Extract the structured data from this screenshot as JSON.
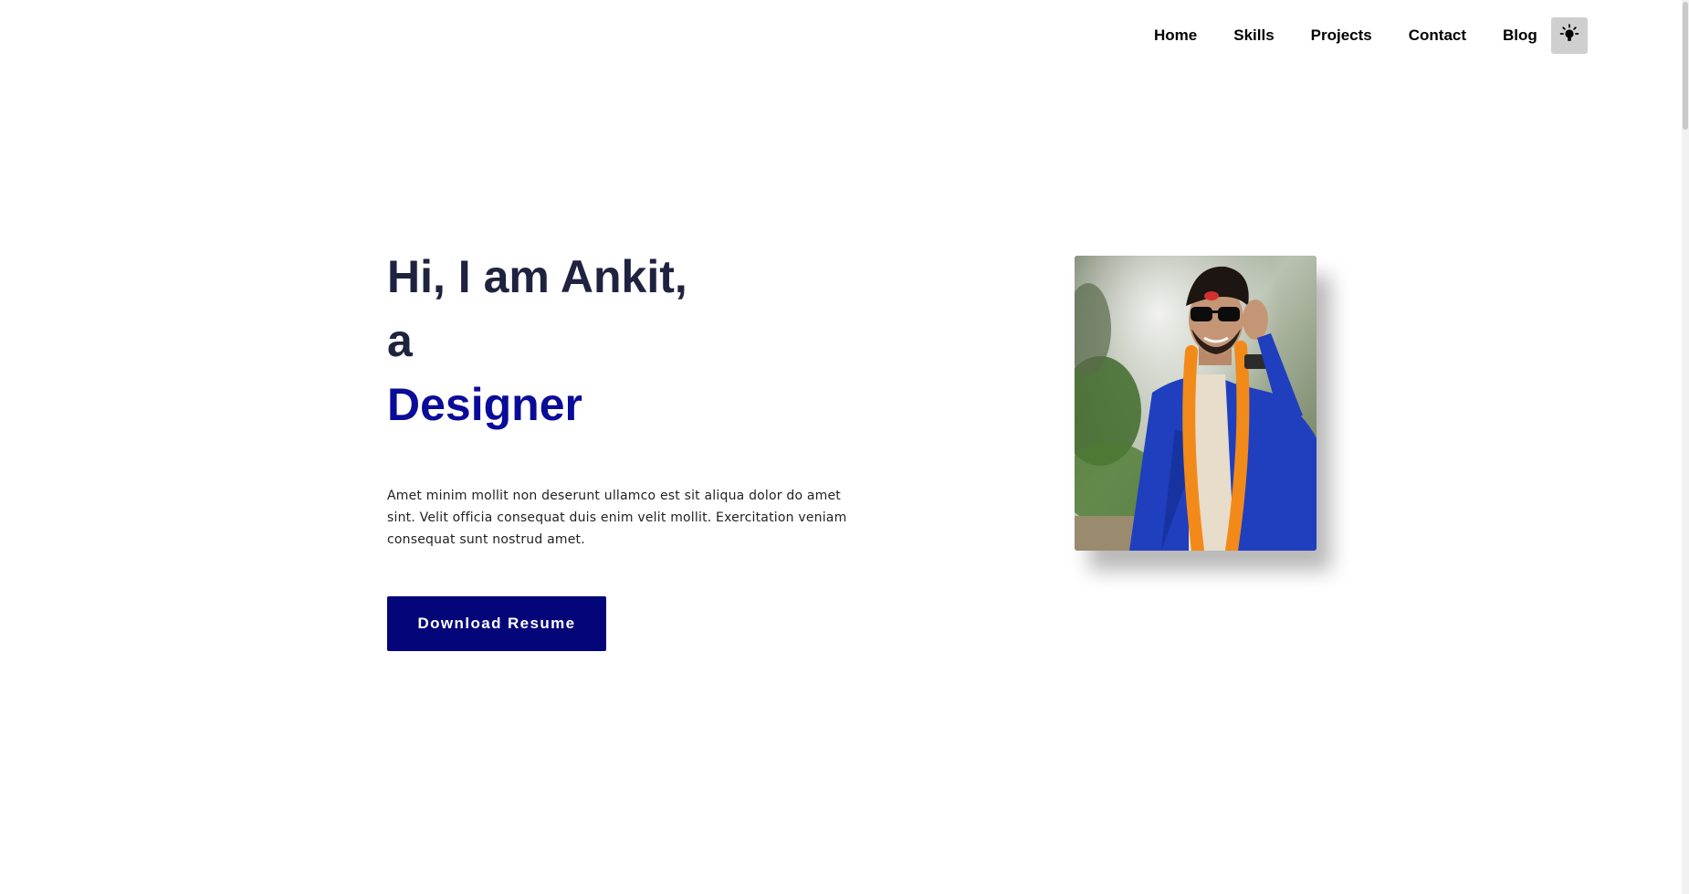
{
  "nav": {
    "links": [
      {
        "label": "Home"
      },
      {
        "label": "Skills"
      },
      {
        "label": "Projects"
      },
      {
        "label": "Contact"
      },
      {
        "label": "Blog"
      }
    ],
    "theme_toggle_icon": "lightbulb-icon"
  },
  "hero": {
    "line1": "Hi, I am Ankit,",
    "line2": "a",
    "role": "Designer",
    "description": "Amet minim mollit non deserunt ullamco est sit aliqua dolor do amet sint. Velit officia consequat duis enim velit mollit. Exercitation veniam consequat sunt nostrud amet.",
    "download_label": "Download Resume"
  },
  "colors": {
    "heading": "#1f2340",
    "accent": "#0b0b99",
    "button_bg": "#05057a",
    "toggle_bg": "#cfcfcf"
  }
}
